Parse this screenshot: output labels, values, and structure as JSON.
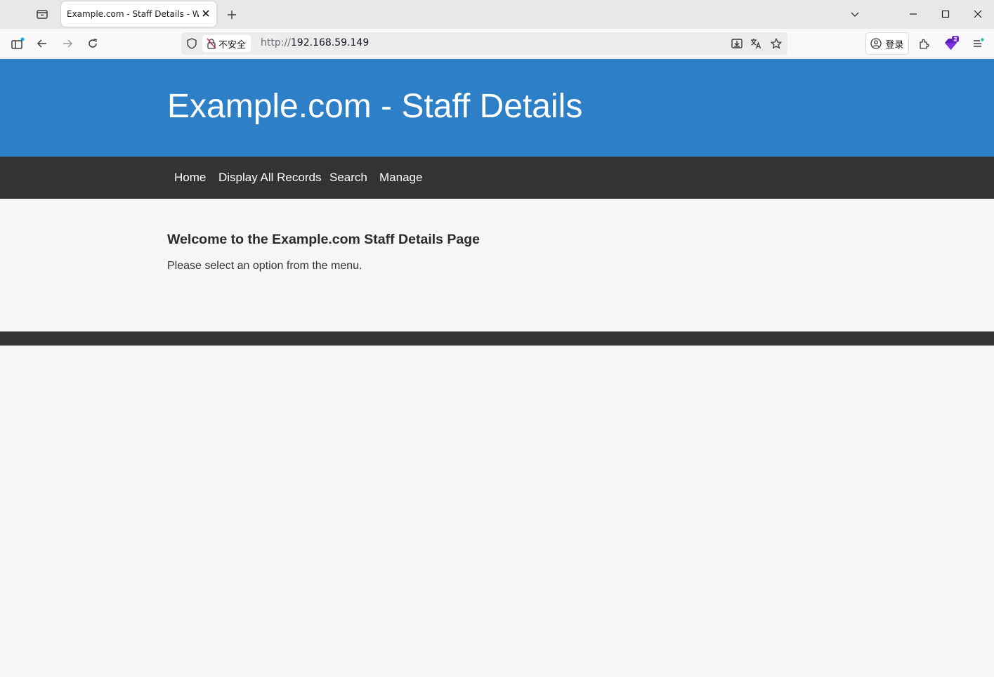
{
  "browser": {
    "tab": {
      "title": "Example.com - Staff Details - Web"
    },
    "urlbar": {
      "insecure_label": "不安全",
      "url_scheme": "http://",
      "url_host": "192.168.59.149"
    },
    "toolbar": {
      "login_label": "登录",
      "extensions_badge": "2"
    }
  },
  "page": {
    "header": {
      "title": "Example.com - Staff Details"
    },
    "nav": {
      "items": [
        {
          "label": "Home"
        },
        {
          "label": "Display All Records"
        },
        {
          "label": "Search"
        },
        {
          "label": "Manage"
        }
      ]
    },
    "main": {
      "heading": "Welcome to the Example.com Staff Details Page",
      "text": "Please select an option from the menu."
    },
    "colors": {
      "header_bg": "#2d80c8",
      "nav_bg": "#333333",
      "page_bg": "#f6f6f6"
    }
  }
}
